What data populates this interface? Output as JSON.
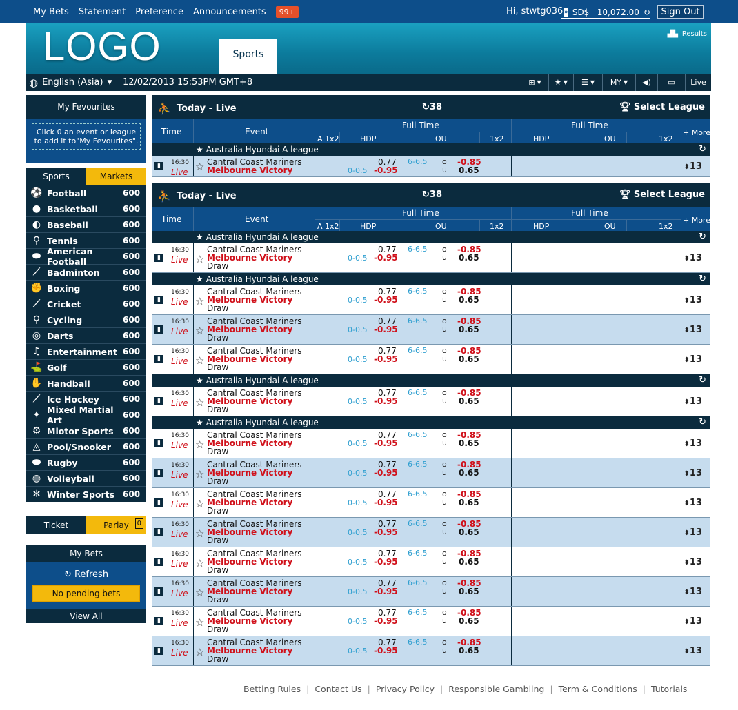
{
  "topnav": {
    "items": [
      "My Bets",
      "Statement",
      "Preference",
      "Announcements"
    ],
    "badge": "99+",
    "greeting": "Hi, stwtg036",
    "balance": "SD$   10,072.00",
    "signout": "Sign Out"
  },
  "header": {
    "logo": "LOGO",
    "tab": "Sports",
    "results": "Results"
  },
  "subbar": {
    "language": "English (Asia)",
    "datetime": "12/02/2013 15:53PM GMT+8",
    "odds_type": "MY",
    "live": "Live"
  },
  "favourites": {
    "title": "My Fevourites",
    "hint": "Click 0 an event or league to add it to\"My Fevourites\"."
  },
  "sports_tabs": {
    "sports": "Sports",
    "markets": "Markets"
  },
  "sports": [
    {
      "name": "Football",
      "count": "600",
      "icon": "football-icon"
    },
    {
      "name": "Basketball",
      "count": "600",
      "icon": "basketball-icon"
    },
    {
      "name": "Baseball",
      "count": "600",
      "icon": "baseball-icon"
    },
    {
      "name": "Tennis",
      "count": "600",
      "icon": "tennis-icon"
    },
    {
      "name": "American Football",
      "count": "600",
      "icon": "american-football-icon"
    },
    {
      "name": "Badminton",
      "count": "600",
      "icon": "badminton-icon"
    },
    {
      "name": "Boxing",
      "count": "600",
      "icon": "boxing-icon"
    },
    {
      "name": "Cricket",
      "count": "600",
      "icon": "cricket-icon"
    },
    {
      "name": "Cycling",
      "count": "600",
      "icon": "cycling-icon"
    },
    {
      "name": "Darts",
      "count": "600",
      "icon": "darts-icon"
    },
    {
      "name": "Entertainment",
      "count": "600",
      "icon": "entertainment-icon"
    },
    {
      "name": "Golf",
      "count": "600",
      "icon": "golf-icon"
    },
    {
      "name": "Handball",
      "count": "600",
      "icon": "handball-icon"
    },
    {
      "name": "Ice Hockey",
      "count": "600",
      "icon": "ice-hockey-icon"
    },
    {
      "name": "Mixed Martial Art",
      "count": "600",
      "icon": "mma-icon"
    },
    {
      "name": "Miotor Sports",
      "count": "600",
      "icon": "motor-sports-icon"
    },
    {
      "name": "Pool/Snooker",
      "count": "600",
      "icon": "pool-icon"
    },
    {
      "name": "Rugby",
      "count": "600",
      "icon": "rugby-icon"
    },
    {
      "name": "Volleyball",
      "count": "600",
      "icon": "volleyball-icon"
    },
    {
      "name": "Winter Sports",
      "count": "600",
      "icon": "winter-sports-icon"
    }
  ],
  "ticket": {
    "ticket": "Ticket",
    "parlay": "Parlay",
    "parlay_count": "0"
  },
  "mybets": {
    "title": "My Bets",
    "refresh": "Refresh",
    "pending": "No pending bets",
    "view_all": "View All"
  },
  "panel": {
    "title": "Today - Live",
    "count": "38",
    "select_league": "Select League"
  },
  "columns": {
    "time": "Time",
    "event": "Event",
    "full_time": "Full Time",
    "more": "+ More",
    "a1x2": "A 1x2",
    "hdp": "HDP",
    "ou": "OU",
    "x12": "1x2"
  },
  "league": "Australia Hyundai A league",
  "match": {
    "time": "16:30",
    "live": "Live",
    "home": "Cantral Coast Mariners",
    "away": "Melbourne Victory",
    "draw": "Draw",
    "hdp_line": "0-0.5",
    "home_odds": "0.77",
    "away_odds": "-0.95",
    "ou_line": "6-6.5",
    "over": "o",
    "under": "u",
    "over_odds": "-0.85",
    "under_odds": "0.65",
    "more_count": "13"
  },
  "footer": [
    "Betting Rules",
    "Contact Us",
    "Privacy Policy",
    "Responsible Gambling",
    "Term & Conditions",
    "Tutorials"
  ]
}
